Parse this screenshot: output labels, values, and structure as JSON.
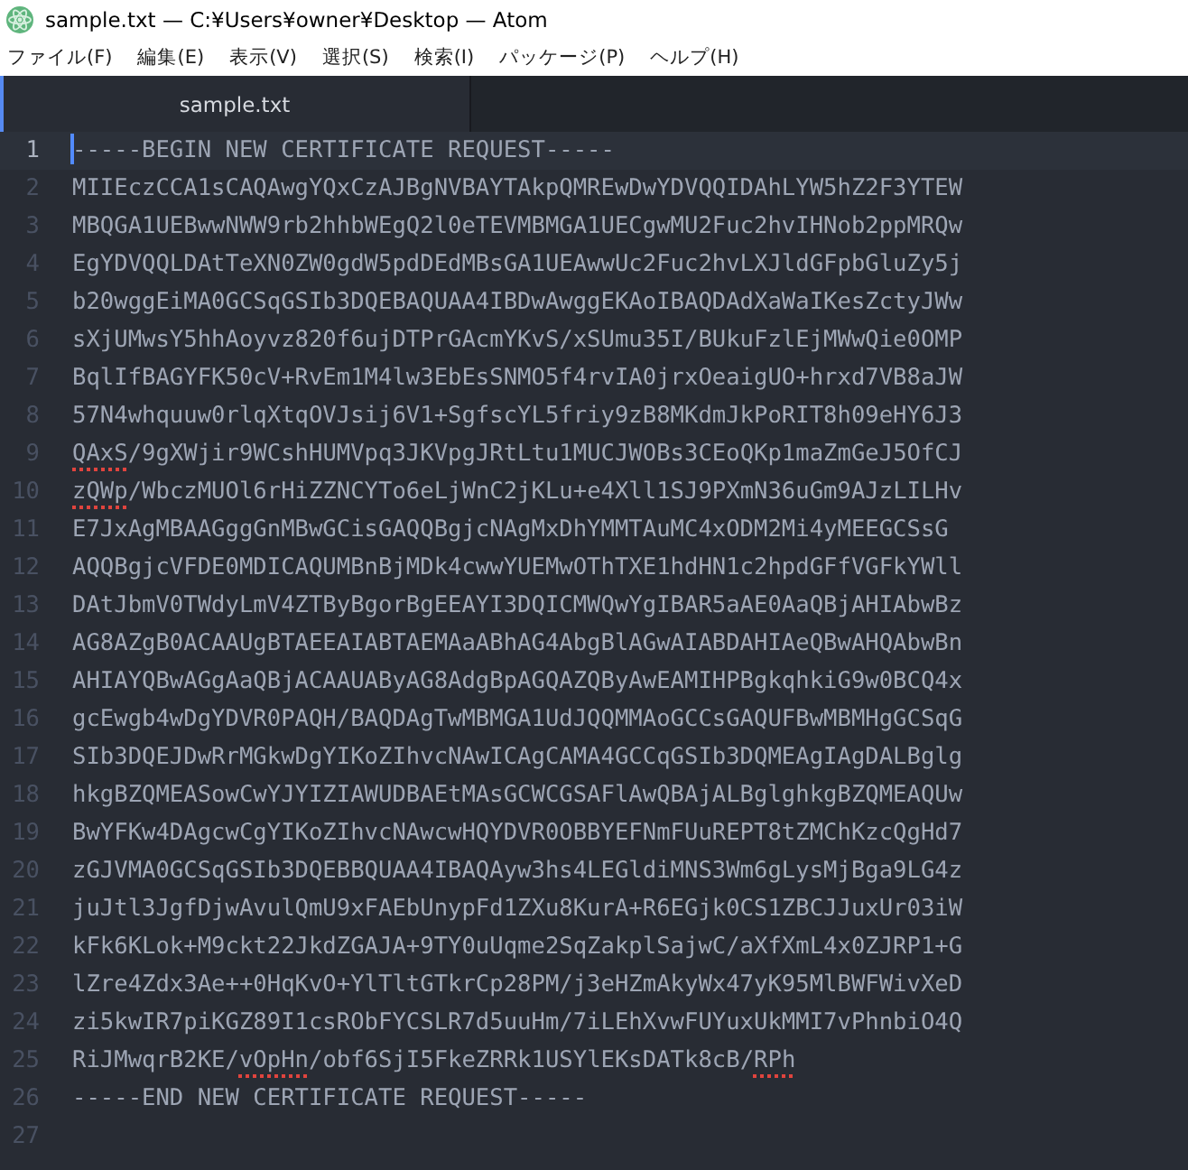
{
  "window": {
    "title": "sample.txt — C:¥Users¥owner¥Desktop — Atom"
  },
  "menu": [
    "ファイル(F)",
    "編集(E)",
    "表示(V)",
    "選択(S)",
    "検索(I)",
    "パッケージ(P)",
    "ヘルプ(H)"
  ],
  "tabs": [
    {
      "label": "sample.txt",
      "selected": true
    }
  ],
  "editor": {
    "lines": [
      {
        "number": "1",
        "current": true,
        "segments": [
          {
            "text": "-----BEGIN NEW CERTIFICATE REQUEST-----",
            "misspelled": false
          }
        ]
      },
      {
        "number": "2",
        "current": false,
        "segments": [
          {
            "text": "MIIEczCCA1sCAQAwgYQxCzAJBgNVBAYTAkpQMREwDwYDVQQIDAhLYW5hZ2F3YTEW",
            "misspelled": false
          }
        ]
      },
      {
        "number": "3",
        "current": false,
        "segments": [
          {
            "text": "MBQGA1UEBwwNWW9rb2hhbWEgQ2l0eTEVMBMGA1UECgwMU2Fuc2hvIHNob2ppMRQw",
            "misspelled": false
          }
        ]
      },
      {
        "number": "4",
        "current": false,
        "segments": [
          {
            "text": "EgYDVQQLDAtTeXN0ZW0gdW5pdDEdMBsGA1UEAwwUc2Fuc2hvLXJldGFpbGluZy5j",
            "misspelled": false
          }
        ]
      },
      {
        "number": "5",
        "current": false,
        "segments": [
          {
            "text": "b20wggEiMA0GCSqGSIb3DQEBAQUAA4IBDwAwggEKAoIBAQDAdXaWaIKesZctyJWw",
            "misspelled": false
          }
        ]
      },
      {
        "number": "6",
        "current": false,
        "segments": [
          {
            "text": "sXjUMwsY5hhAoyvz820f6ujDTPrGAcmYKvS/xSUmu35I/BUkuFzlEjMWwQie0OMP",
            "misspelled": false
          }
        ]
      },
      {
        "number": "7",
        "current": false,
        "segments": [
          {
            "text": "BqlIfBAGYFK50cV+RvEm1M4lw3EbEsSNMO5f4rvIA0jrxOeaigUO+hrxd7VB8aJW",
            "misspelled": false
          }
        ]
      },
      {
        "number": "8",
        "current": false,
        "segments": [
          {
            "text": "57N4whquuw0rlqXtqOVJsij6V1+SgfscYL5friy9zB8MKdmJkPoRIT8h09eHY6J3",
            "misspelled": false
          }
        ]
      },
      {
        "number": "9",
        "current": false,
        "segments": [
          {
            "text": "QAxS",
            "misspelled": true
          },
          {
            "text": "/9gXWjir9WCshHUMVpq3JKVpgJRtLtu1MUCJWOBs3CEoQKp1maZmGeJ5OfCJ",
            "misspelled": false
          }
        ]
      },
      {
        "number": "10",
        "current": false,
        "segments": [
          {
            "text": "zQWp",
            "misspelled": true
          },
          {
            "text": "/WbczMUOl6rHiZZNCYTo6eLjWnC2jKLu+e4Xll1SJ9PXmN36uGm9AJzLILHv",
            "misspelled": false
          }
        ]
      },
      {
        "number": "11",
        "current": false,
        "segments": [
          {
            "text": "E7JxAgMBAAGggGnMBwGCisGAQQBgjcNAgMxDhYMMTAuMC4xODM2Mi4yMEEGCSsG",
            "misspelled": false
          }
        ]
      },
      {
        "number": "12",
        "current": false,
        "segments": [
          {
            "text": "AQQBgjcVFDE0MDICAQUMBnBjMDk4cwwYUEMwOThTXE1hdHN1c2hpdGFfVGFkYWll",
            "misspelled": false
          }
        ]
      },
      {
        "number": "13",
        "current": false,
        "segments": [
          {
            "text": "DAtJbmV0TWdyLmV4ZTByBgorBgEEAYI3DQICMWQwYgIBAR5aAE0AaQBjAHIAbwBz",
            "misspelled": false
          }
        ]
      },
      {
        "number": "14",
        "current": false,
        "segments": [
          {
            "text": "AG8AZgB0ACAAUgBTAEEAIABTAEMAaABhAG4AbgBlAGwAIABDAHIAeQBwAHQAbwBn",
            "misspelled": false
          }
        ]
      },
      {
        "number": "15",
        "current": false,
        "segments": [
          {
            "text": "AHIAYQBwAGgAaQBjACAAUAByAG8AdgBpAGQAZQByAwEAMIHPBgkqhkiG9w0BCQ4x",
            "misspelled": false
          }
        ]
      },
      {
        "number": "16",
        "current": false,
        "segments": [
          {
            "text": "gcEwgb4wDgYDVR0PAQH/BAQDAgTwMBMGA1UdJQQMMAoGCCsGAQUFBwMBMHgGCSqG",
            "misspelled": false
          }
        ]
      },
      {
        "number": "17",
        "current": false,
        "segments": [
          {
            "text": "SIb3DQEJDwRrMGkwDgYIKoZIhvcNAwICAgCAMA4GCCqGSIb3DQMEAgIAgDALBglg",
            "misspelled": false
          }
        ]
      },
      {
        "number": "18",
        "current": false,
        "segments": [
          {
            "text": "hkgBZQMEASowCwYJYIZIAWUDBAEtMAsGCWCGSAFlAwQBAjALBglghkgBZQMEAQUw",
            "misspelled": false
          }
        ]
      },
      {
        "number": "19",
        "current": false,
        "segments": [
          {
            "text": "BwYFKw4DAgcwCgYIKoZIhvcNAwcwHQYDVR0OBBYEFNmFUuREPT8tZMChKzcQgHd7",
            "misspelled": false
          }
        ]
      },
      {
        "number": "20",
        "current": false,
        "segments": [
          {
            "text": "zGJVMA0GCSqGSIb3DQEBBQUAA4IBAQAyw3hs4LEGldiMNS3Wm6gLysMjBga9LG4z",
            "misspelled": false
          }
        ]
      },
      {
        "number": "21",
        "current": false,
        "segments": [
          {
            "text": "juJtl3JgfDjwAvulQmU9xFAEbUnypFd1ZXu8KurA+R6EGjk0CS1ZBCJJuxUr03iW",
            "misspelled": false
          }
        ]
      },
      {
        "number": "22",
        "current": false,
        "segments": [
          {
            "text": "kFk6KLok+M9ckt22JkdZGAJA+9TY0uUqme2SqZakplSajwC/aXfXmL4x0ZJRP1+G",
            "misspelled": false
          }
        ]
      },
      {
        "number": "23",
        "current": false,
        "segments": [
          {
            "text": "lZre4Zdx3Ae++0HqKvO+YlTltGTkrCp28PM/j3eHZmAkyWx47yK95MlBWFWivXeD",
            "misspelled": false
          }
        ]
      },
      {
        "number": "24",
        "current": false,
        "segments": [
          {
            "text": "zi5kwIR7piKGZ89I1csRObFYCSLR7d5uuHm/7iLEhXvwFUYuxUkMMI7vPhnbiO4Q",
            "misspelled": false
          }
        ]
      },
      {
        "number": "25",
        "current": false,
        "segments": [
          {
            "text": "RiJMwqrB2KE/",
            "misspelled": false
          },
          {
            "text": "vOpHn",
            "misspelled": true
          },
          {
            "text": "/obf6SjI5FkeZRRk1USYlEKsDATk8cB/",
            "misspelled": false
          },
          {
            "text": "RPh",
            "misspelled": true
          }
        ]
      },
      {
        "number": "26",
        "current": false,
        "segments": [
          {
            "text": "-----END NEW CERTIFICATE REQUEST-----",
            "misspelled": false
          }
        ]
      },
      {
        "number": "27",
        "current": false
      }
    ]
  }
}
